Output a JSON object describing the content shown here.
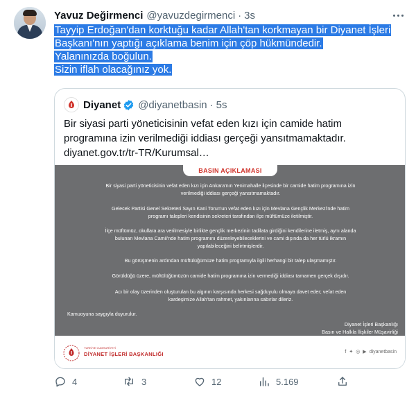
{
  "tweet": {
    "author_name": "Yavuz Değirmenci",
    "author_handle": "@yavuzdegirmenci",
    "dot": "·",
    "time": "3s",
    "text_lines": [
      "Tayyip Erdoğan'dan korktuğu kadar Allah'tan korkmayan bir Diyanet İşleri",
      "Başkanı'nın yaptığı açıklama benim için çöp hükmündedir.",
      "Yalanınızda boğulun.",
      "Sizin iflah olacağınız yok."
    ],
    "selection_color": "#2c7be5"
  },
  "quote": {
    "author_name": "Diyanet",
    "author_handle": "@diyanetbasin",
    "dot": "·",
    "time": "5s",
    "text_lines": [
      "Bir siyasi parti yöneticisinin vefat eden kızı için camide hatim",
      "programına izin verilmediği iddiası gerçeği yansıtmamaktadır.",
      "diyanet.gov.tr/tr-TR/Kurumsal…"
    ],
    "press_release": {
      "title": "BASIN AÇIKLAMASI",
      "paragraphs": [
        [
          "Bir siyasi parti yöneticisinin vefat eden kızı için Ankara'nın Yenimahalle ilçesinde bir camide hatim programına izin",
          "verilmediği iddiası gerçeği yansıtmamaktadır."
        ],
        [
          "Gelecek Partisi Genel Sekreteri Sayın Kani Torun'un vefat eden kızı için Mevlana Gençlik Merkezi'nde hatim",
          "programı talepleri kendisinin sekreteri tarafından ilçe müftümüze iletilmiştir."
        ],
        [
          "İlçe müftümüz, okullara ara verilmesiyle birlikte gençlik merkezinin tadilata girdiğini kendilerine iletmiş, aynı alanda",
          "bulunan Mevlana Camii'nde hatim programını düzenleyebileceklerini ve cami dışında da her türlü ikramın",
          "yapılabileceğini belirtmişlerdir."
        ],
        [
          "Bu görüşmenin ardından müftülüğümüze hatim programıyla ilgili herhangi bir talep ulaşmamıştır."
        ],
        [
          "Görüldüğü üzere, müftülüğümüzün camide hatim programına izin vermediği iddiası tamamen gerçek dışıdır."
        ],
        [
          "Acı bir olay üzerinden oluşturulan bu algının karşısında herkesi sağduyulu olmaya davet eder; vefat eden",
          "kardeşimize Allah'tan rahmet, yakınlarına sabırlar dileriz."
        ],
        [
          "Kamuoyuna saygıyla duyurulur."
        ]
      ],
      "signature": [
        "Diyanet İşleri Başkanlığı",
        "Basın ve Halkla İlişkiler Müşavirliği"
      ],
      "footer_org": "DİYANET İŞLERİ BAŞKANLIĞI",
      "footer_sub": "TÜRKİYE CUMHURİYETİ",
      "footer_social_handle": "diyanetbasin",
      "footer_social_icons": [
        "facebook-icon",
        "twitter-icon",
        "instagram-icon",
        "youtube-icon"
      ]
    }
  },
  "actions": {
    "reply_count": "4",
    "retweet_count": "3",
    "like_count": "12",
    "views_count": "5.169"
  },
  "colors": {
    "text_primary": "#0f1419",
    "text_secondary": "#536471",
    "border": "#cfd9de",
    "press_bg": "#6d6e70",
    "press_accent": "#d0342c",
    "verified": "#1d9bf0"
  }
}
